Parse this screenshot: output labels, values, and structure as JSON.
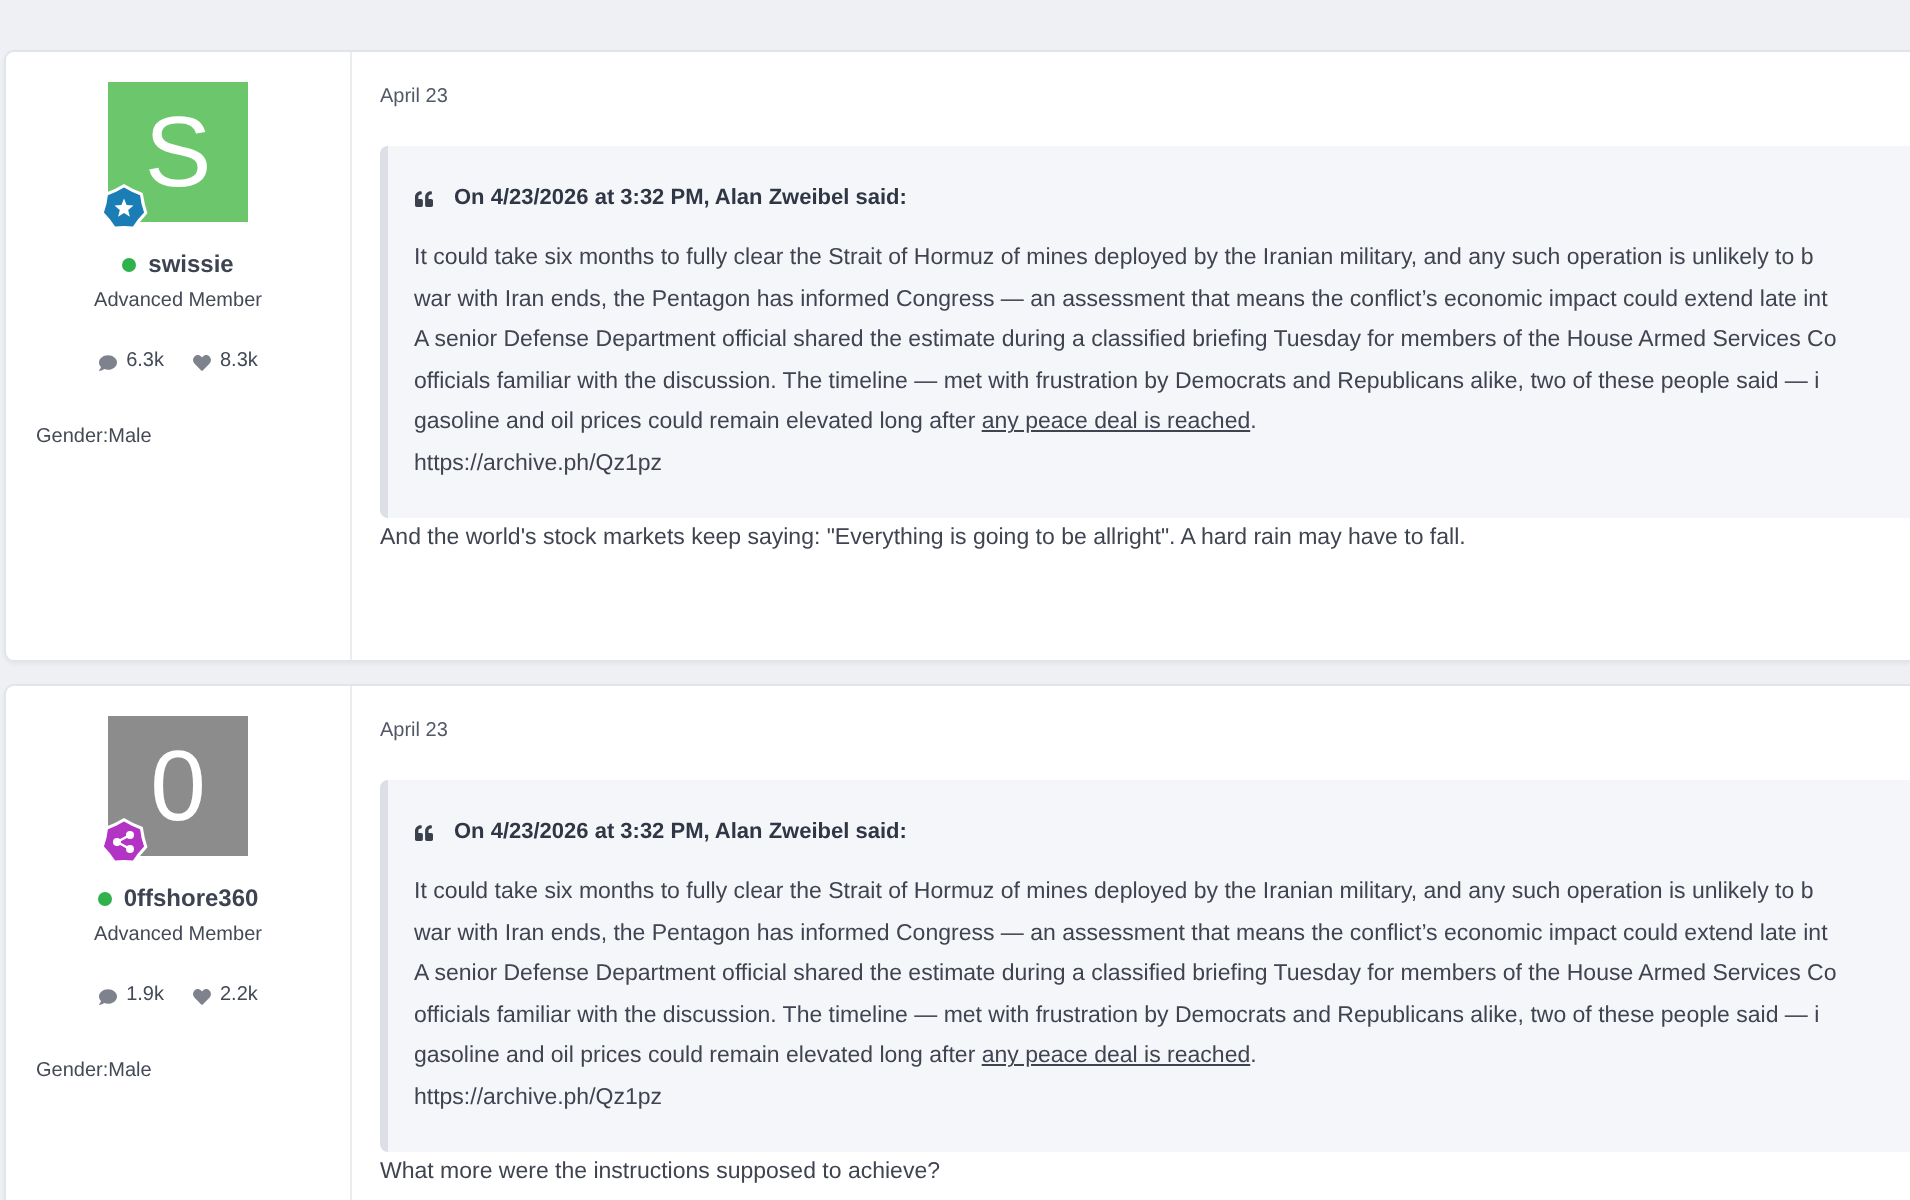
{
  "posts": [
    {
      "author": {
        "initial": "S",
        "color": "#6cc66c",
        "badge": {
          "kind": "star",
          "color": "#1b7db5"
        },
        "online": true,
        "name": "swissie",
        "rank": "Advanced Member",
        "comments": "6.3k",
        "likes": "8.3k",
        "gender": "Gender:Male"
      },
      "date": "April 23",
      "quote": {
        "header": "On 4/23/2026 at 3:32 PM, Alan Zweibel said:",
        "lines": [
          "It could take six months to fully clear the Strait of Hormuz of mines deployed by the Iranian military, and any such operation is unlikely to b",
          "war with Iran ends, the Pentagon has informed Congress — an assessment that means the conflict’s economic impact could extend late int",
          "A senior Defense Department official shared the estimate during a classified briefing Tuesday for members of the House Armed Services Co",
          "officials familiar with the discussion. The timeline — met with frustration by Democrats and Republicans alike, two of these people said — i"
        ],
        "last_line": {
          "before": "gasoline and oil prices could remain elevated long after ",
          "link": "any peace deal is reached",
          "after": "."
        },
        "url": "https://archive.ph/Qz1pz"
      },
      "reply": "And the world's stock markets keep saying: \"Everything is going to be allright\". A hard rain may have to fall."
    },
    {
      "author": {
        "initial": "0",
        "color": "#8c8c8c",
        "badge": {
          "kind": "nodes",
          "color": "#b334c4"
        },
        "online": true,
        "name": "0ffshore360",
        "rank": "Advanced Member",
        "comments": "1.9k",
        "likes": "2.2k",
        "gender": "Gender:Male"
      },
      "date": "April 23",
      "quote": {
        "header": "On 4/23/2026 at 3:32 PM, Alan Zweibel said:",
        "lines": [
          "It could take six months to fully clear the Strait of Hormuz of mines deployed by the Iranian military, and any such operation is unlikely to b",
          "war with Iran ends, the Pentagon has informed Congress — an assessment that means the conflict’s economic impact could extend late int",
          "A senior Defense Department official shared the estimate during a classified briefing Tuesday for members of the House Armed Services Co",
          "officials familiar with the discussion. The timeline — met with frustration by Democrats and Republicans alike, two of these people said — i"
        ],
        "last_line": {
          "before": "gasoline and oil prices could remain elevated long after ",
          "link": "any peace deal is reached",
          "after": "."
        },
        "url": "https://archive.ph/Qz1pz"
      },
      "reply": "What more were the instructions supposed to achieve?"
    }
  ]
}
